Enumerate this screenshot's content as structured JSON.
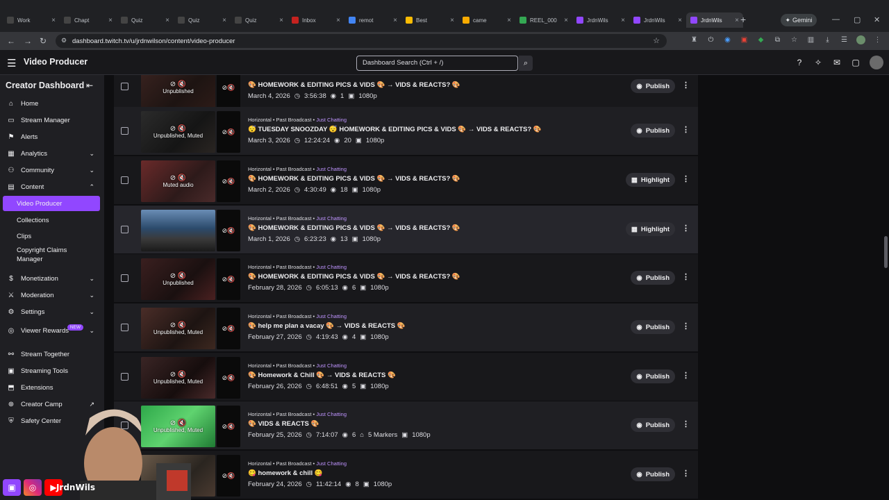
{
  "browser": {
    "tabs": [
      {
        "label": "Work",
        "color": "#444"
      },
      {
        "label": "Chapt",
        "color": "#444"
      },
      {
        "label": "Quiz",
        "color": "#444"
      },
      {
        "label": "Quiz",
        "color": "#444"
      },
      {
        "label": "Quiz",
        "color": "#444"
      },
      {
        "label": "Inbox",
        "color": "#c5221f"
      },
      {
        "label": "remot",
        "color": "#4285f4"
      },
      {
        "label": "Best",
        "color": "#fbbc04"
      },
      {
        "label": "came",
        "color": "#f9ab00"
      },
      {
        "label": "REEL_000",
        "color": "#34a853"
      },
      {
        "label": "JrdnWils",
        "color": "#9147ff"
      },
      {
        "label": "JrdnWils",
        "color": "#9147ff"
      },
      {
        "label": "JrdnWils",
        "color": "#9147ff"
      }
    ],
    "gemini_label": "Gemini",
    "url": "dashboard.twitch.tv/u/jrdnwilson/content/video-producer"
  },
  "header": {
    "app_name": "Video Producer",
    "search_placeholder": "Dashboard Search (Ctrl + /)"
  },
  "sidebar": {
    "title": "Creator Dashboard",
    "items": [
      {
        "label": "Home",
        "icon": "⌂"
      },
      {
        "label": "Stream Manager",
        "icon": "▭"
      },
      {
        "label": "Alerts",
        "icon": "⚑"
      },
      {
        "label": "Analytics",
        "icon": "▦"
      },
      {
        "label": "Community",
        "icon": "⚇"
      },
      {
        "label": "Content",
        "icon": "▤"
      },
      {
        "label": "Video Producer"
      },
      {
        "label": "Collections"
      },
      {
        "label": "Clips"
      },
      {
        "label": "Copyright Claims Manager"
      },
      {
        "label": "Monetization",
        "icon": "$"
      },
      {
        "label": "Moderation",
        "icon": "⚔"
      },
      {
        "label": "Settings",
        "icon": "⚙"
      },
      {
        "label": "Viewer Rewards",
        "icon": "◎"
      },
      {
        "label": "Stream Together",
        "icon": "⚯"
      },
      {
        "label": "Streaming Tools",
        "icon": "▣"
      },
      {
        "label": "Extensions",
        "icon": "⬒"
      },
      {
        "label": "Creator Camp",
        "icon": "⊕"
      },
      {
        "label": "Safety Center",
        "icon": "⛨"
      }
    ],
    "new_badge": "NEW"
  },
  "videos": [
    {
      "meta": "",
      "category": "",
      "title": "🎨 HOMEWORK & EDITING PICS & VIDS 🎨 → VIDS & REACTS? 🎨",
      "date": "March 4, 2026",
      "duration": "3:56:38",
      "views": "1",
      "markers": "",
      "quality": "1080p",
      "overlay": "Unpublished",
      "action": "Publish"
    },
    {
      "meta": "Horizontal • Past Broadcast • ",
      "category": "Just Chatting",
      "title": "😴 TUESDAY SNOOZDAY 😴 HOMEWORK & EDITING PICS & VIDS 🎨 → VIDS & REACTS? 🎨",
      "date": "March 3, 2026",
      "duration": "12:24:24",
      "views": "20",
      "markers": "",
      "quality": "1080p",
      "overlay": "Unpublished, Muted",
      "action": "Publish"
    },
    {
      "meta": "Horizontal • Past Broadcast • ",
      "category": "Just Chatting",
      "title": "🎨 HOMEWORK & EDITING PICS & VIDS 🎨 → VIDS & REACTS? 🎨",
      "date": "March 2, 2026",
      "duration": "4:30:49",
      "views": "18",
      "markers": "",
      "quality": "1080p",
      "overlay": "Muted audio",
      "action": "Highlight"
    },
    {
      "meta": "Horizontal • Past Broadcast • ",
      "category": "Just Chatting",
      "title": "🎨 HOMEWORK & EDITING PICS & VIDS 🎨 → VIDS & REACTS? 🎨",
      "date": "March 1, 2026",
      "duration": "6:23:23",
      "views": "13",
      "markers": "",
      "quality": "1080p",
      "overlay": "",
      "action": "Highlight"
    },
    {
      "meta": "Horizontal • Past Broadcast • ",
      "category": "Just Chatting",
      "title": "🎨 HOMEWORK & EDITING PICS & VIDS 🎨 → VIDS & REACTS? 🎨",
      "date": "February 28, 2026",
      "duration": "6:05:13",
      "views": "6",
      "markers": "",
      "quality": "1080p",
      "overlay": "Unpublished",
      "action": "Publish"
    },
    {
      "meta": "Horizontal • Past Broadcast • ",
      "category": "Just Chatting",
      "title": "🎨 help me plan a vacay 🎨 → VIDS & REACTS 🎨",
      "date": "February 27, 2026",
      "duration": "4:19:43",
      "views": "4",
      "markers": "",
      "quality": "1080p",
      "overlay": "Unpublished, Muted",
      "action": "Publish"
    },
    {
      "meta": "Horizontal • Past Broadcast • ",
      "category": "Just Chatting",
      "title": "🎨 Homework & Chill 🎨 → VIDS & REACTS 🎨",
      "date": "February 26, 2026",
      "duration": "6:48:51",
      "views": "5",
      "markers": "",
      "quality": "1080p",
      "overlay": "Unpublished, Muted",
      "action": "Publish"
    },
    {
      "meta": "Horizontal • Past Broadcast • ",
      "category": "Just Chatting",
      "title": "🎨 VIDS & REACTS 🎨",
      "date": "February 25, 2026",
      "duration": "7:14:07",
      "views": "6",
      "markers": "5 Markers",
      "quality": "1080p",
      "overlay": "Unpublished, Muted",
      "action": "Publish"
    },
    {
      "meta": "Horizontal • Past Broadcast • ",
      "category": "Just Chatting",
      "title": "😋 homework & chill 😋",
      "date": "February 24, 2026",
      "duration": "11:42:14",
      "views": "8",
      "markers": "",
      "quality": "1080p",
      "overlay": "Muted",
      "action": "Publish"
    }
  ],
  "overlay_watermark": "JrdnWils"
}
